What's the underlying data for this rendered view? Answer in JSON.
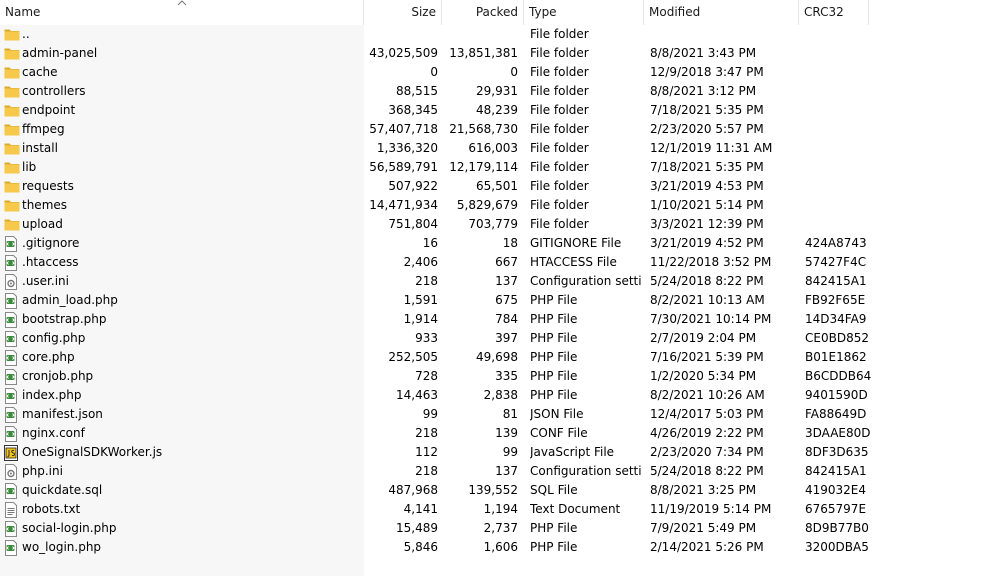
{
  "columns": {
    "name": "Name",
    "size": "Size",
    "packed": "Packed",
    "type": "Type",
    "modified": "Modified",
    "crc": "CRC32"
  },
  "files": [
    {
      "icon": "folder-up-icon",
      "name": "..",
      "size": "",
      "packed": "",
      "type": "File folder",
      "modified": "",
      "crc": ""
    },
    {
      "icon": "folder-icon",
      "name": "admin-panel",
      "size": "43,025,509",
      "packed": "13,851,381",
      "type": "File folder",
      "modified": "8/8/2021 3:43 PM",
      "crc": ""
    },
    {
      "icon": "folder-icon",
      "name": "cache",
      "size": "0",
      "packed": "0",
      "type": "File folder",
      "modified": "12/9/2018 3:47 PM",
      "crc": ""
    },
    {
      "icon": "folder-icon",
      "name": "controllers",
      "size": "88,515",
      "packed": "29,931",
      "type": "File folder",
      "modified": "8/8/2021 3:12 PM",
      "crc": ""
    },
    {
      "icon": "folder-icon",
      "name": "endpoint",
      "size": "368,345",
      "packed": "48,239",
      "type": "File folder",
      "modified": "7/18/2021 5:35 PM",
      "crc": ""
    },
    {
      "icon": "folder-icon",
      "name": "ffmpeg",
      "size": "57,407,718",
      "packed": "21,568,730",
      "type": "File folder",
      "modified": "2/23/2020 5:57 PM",
      "crc": ""
    },
    {
      "icon": "folder-icon",
      "name": "install",
      "size": "1,336,320",
      "packed": "616,003",
      "type": "File folder",
      "modified": "12/1/2019 11:31 AM",
      "crc": ""
    },
    {
      "icon": "folder-icon",
      "name": "lib",
      "size": "56,589,791",
      "packed": "12,179,114",
      "type": "File folder",
      "modified": "7/18/2021 5:35 PM",
      "crc": ""
    },
    {
      "icon": "folder-icon",
      "name": "requests",
      "size": "507,922",
      "packed": "65,501",
      "type": "File folder",
      "modified": "3/21/2019 4:53 PM",
      "crc": ""
    },
    {
      "icon": "folder-icon",
      "name": "themes",
      "size": "14,471,934",
      "packed": "5,829,679",
      "type": "File folder",
      "modified": "1/10/2021 5:14 PM",
      "crc": ""
    },
    {
      "icon": "folder-icon",
      "name": "upload",
      "size": "751,804",
      "packed": "703,779",
      "type": "File folder",
      "modified": "3/3/2021 12:39 PM",
      "crc": ""
    },
    {
      "icon": "code-file-icon",
      "name": ".gitignore",
      "size": "16",
      "packed": "18",
      "type": "GITIGNORE File",
      "modified": "3/21/2019 4:52 PM",
      "crc": "424A8743"
    },
    {
      "icon": "code-file-icon",
      "name": ".htaccess",
      "size": "2,406",
      "packed": "667",
      "type": "HTACCESS File",
      "modified": "11/22/2018 3:52 PM",
      "crc": "57427F4C"
    },
    {
      "icon": "settings-file-icon",
      "name": ".user.ini",
      "size": "218",
      "packed": "137",
      "type": "Configuration setti...",
      "modified": "5/24/2018 8:22 PM",
      "crc": "842415A1"
    },
    {
      "icon": "code-file-icon",
      "name": "admin_load.php",
      "size": "1,591",
      "packed": "675",
      "type": "PHP File",
      "modified": "8/2/2021 10:13 AM",
      "crc": "FB92F65E"
    },
    {
      "icon": "code-file-icon",
      "name": "bootstrap.php",
      "size": "1,914",
      "packed": "784",
      "type": "PHP File",
      "modified": "7/30/2021 10:14 PM",
      "crc": "14D34FA9"
    },
    {
      "icon": "code-file-icon",
      "name": "config.php",
      "size": "933",
      "packed": "397",
      "type": "PHP File",
      "modified": "2/7/2019 2:04 PM",
      "crc": "CE0BD852"
    },
    {
      "icon": "code-file-icon",
      "name": "core.php",
      "size": "252,505",
      "packed": "49,698",
      "type": "PHP File",
      "modified": "7/16/2021 5:39 PM",
      "crc": "B01E1862"
    },
    {
      "icon": "code-file-icon",
      "name": "cronjob.php",
      "size": "728",
      "packed": "335",
      "type": "PHP File",
      "modified": "1/2/2020 5:34 PM",
      "crc": "B6CDDB64"
    },
    {
      "icon": "code-file-icon",
      "name": "index.php",
      "size": "14,463",
      "packed": "2,838",
      "type": "PHP File",
      "modified": "8/2/2021 10:26 AM",
      "crc": "9401590D"
    },
    {
      "icon": "code-file-icon",
      "name": "manifest.json",
      "size": "99",
      "packed": "81",
      "type": "JSON File",
      "modified": "12/4/2017 5:03 PM",
      "crc": "FA88649D"
    },
    {
      "icon": "code-file-icon",
      "name": "nginx.conf",
      "size": "218",
      "packed": "139",
      "type": "CONF File",
      "modified": "4/26/2019 2:22 PM",
      "crc": "3DAAE80D"
    },
    {
      "icon": "javascript-file-icon",
      "name": "OneSignalSDKWorker.js",
      "size": "112",
      "packed": "99",
      "type": "JavaScript File",
      "modified": "2/23/2020 7:34 PM",
      "crc": "8DF3D635"
    },
    {
      "icon": "settings-file-icon",
      "name": "php.ini",
      "size": "218",
      "packed": "137",
      "type": "Configuration setti...",
      "modified": "5/24/2018 8:22 PM",
      "crc": "842415A1"
    },
    {
      "icon": "code-file-icon",
      "name": "quickdate.sql",
      "size": "487,968",
      "packed": "139,552",
      "type": "SQL File",
      "modified": "8/8/2021 3:25 PM",
      "crc": "419032E4"
    },
    {
      "icon": "text-file-icon",
      "name": "robots.txt",
      "size": "4,141",
      "packed": "1,194",
      "type": "Text Document",
      "modified": "11/19/2019 5:14 PM",
      "crc": "6765797E"
    },
    {
      "icon": "code-file-icon",
      "name": "social-login.php",
      "size": "15,489",
      "packed": "2,737",
      "type": "PHP File",
      "modified": "7/9/2021 5:49 PM",
      "crc": "8D9B77B0"
    },
    {
      "icon": "code-file-icon",
      "name": "wo_login.php",
      "size": "5,846",
      "packed": "1,606",
      "type": "PHP File",
      "modified": "2/14/2021 5:26 PM",
      "crc": "3200DBA5"
    }
  ],
  "colors": {
    "folder": "#f4c542",
    "folder_dark": "#d9a520",
    "code_green": "#3c8a3c"
  }
}
